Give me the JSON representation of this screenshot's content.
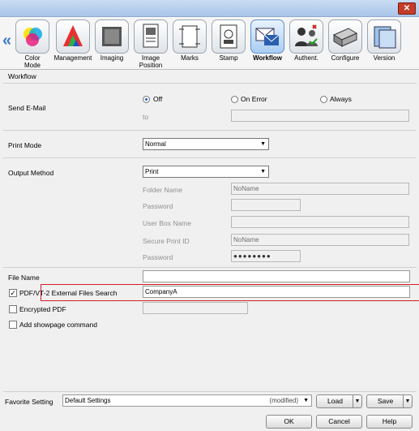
{
  "window": {
    "title": "",
    "close_glyph": "✕"
  },
  "toolbar": {
    "left_arrow": "«",
    "buttons": [
      {
        "label": "Color\nMode",
        "icon": "color-wheel-icon"
      },
      {
        "label": "Management",
        "icon": "color-triangle-icon"
      },
      {
        "label": "Imaging",
        "icon": "imaging-icon"
      },
      {
        "label": "Image\nPosition",
        "icon": "image-position-icon"
      },
      {
        "label": "Marks",
        "icon": "marks-icon"
      },
      {
        "label": "Stamp",
        "icon": "stamp-icon"
      },
      {
        "label": "Workflow",
        "icon": "workflow-icon"
      },
      {
        "label": "Authent.",
        "icon": "authentication-icon"
      },
      {
        "label": "Configure",
        "icon": "printer-configure-icon"
      },
      {
        "label": "Version",
        "icon": "version-icon"
      }
    ]
  },
  "section_title": "Workflow",
  "send_email": {
    "label": "Send E-Mail",
    "options": [
      "Off",
      "On Error",
      "Always"
    ],
    "selected": "Off",
    "to_label": "to",
    "to_value": ""
  },
  "print_mode": {
    "label": "Print Mode",
    "value": "Normal"
  },
  "output_method": {
    "label": "Output Method",
    "value": "Print",
    "folder_name_label": "Folder Name",
    "folder_name_value": "NoName",
    "password_label": "Password",
    "password_value": "",
    "user_box_label": "User Box Name",
    "user_box_value": "",
    "secure_id_label": "Secure Print ID",
    "secure_id_value": "NoName",
    "secure_password_label": "Password",
    "secure_password_value": "●●●●●●●●"
  },
  "file_name": {
    "label": "File Name",
    "value": ""
  },
  "pdf_search": {
    "label": "PDF/VT-2 External Files Search",
    "checked": true,
    "value": "CompanyA",
    "check_glyph": "✓"
  },
  "encrypted_pdf": {
    "label": "Encrypted PDF",
    "checked": false,
    "value": ""
  },
  "showpage": {
    "label": "Add showpage command",
    "checked": false
  },
  "favorite": {
    "label": "Favorite Setting",
    "value": "Default Settings",
    "status": "(modified)",
    "dropdown_glyph": "▼"
  },
  "buttons": {
    "load": "Load",
    "save": "Save",
    "ok": "OK",
    "cancel": "Cancel",
    "help": "Help"
  }
}
